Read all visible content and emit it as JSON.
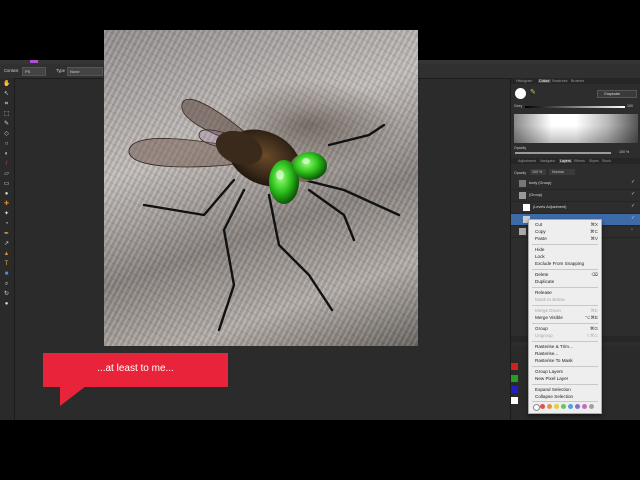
{
  "context_toolbar": {
    "contract_label": "Context",
    "contract_value": "PS",
    "type_label": "Type",
    "type_value": "None"
  },
  "panel": {
    "top_tabs": [
      {
        "label": "Histogram",
        "active": false
      },
      {
        "label": "Colour",
        "active": true
      },
      {
        "label": "Swatches",
        "active": false
      },
      {
        "label": "Brushes",
        "active": false
      }
    ],
    "colour_mode": "Grayscale",
    "grey_label": "Grey",
    "grey_value": "100",
    "opacity_label": "Opacity",
    "opacity_value": "100 %",
    "layer_tabs": [
      {
        "label": "Adjustment",
        "active": false
      },
      {
        "label": "Navigator",
        "active": false
      },
      {
        "label": "Layers",
        "active": true
      },
      {
        "label": "Effects",
        "active": false
      },
      {
        "label": "Styles",
        "active": false
      },
      {
        "label": "Stock",
        "active": false
      }
    ],
    "layer_opacity_label": "Opacity",
    "layer_opacity_value": "100 %",
    "blend_mode": "Normal",
    "layers": [
      {
        "name": "body (Group)",
        "selected": false
      },
      {
        "name": "(Group)",
        "selected": false
      },
      {
        "name": "(Levels Adjustment)",
        "selected": false
      },
      {
        "name": "",
        "selected": true
      },
      {
        "name": "",
        "selected": false
      }
    ]
  },
  "context_menu": {
    "items": [
      {
        "label": "Cut",
        "shortcut": "⌘X",
        "disabled": false
      },
      {
        "label": "Copy",
        "shortcut": "⌘C",
        "disabled": false
      },
      {
        "label": "Paste",
        "shortcut": "⌘V",
        "disabled": false
      },
      {
        "label": "Hide",
        "shortcut": "",
        "disabled": false
      },
      {
        "label": "Lock",
        "shortcut": "",
        "disabled": false
      },
      {
        "label": "Exclude From Snapping",
        "shortcut": "",
        "disabled": false
      },
      {
        "label": "Delete",
        "shortcut": "⌫",
        "disabled": false
      },
      {
        "label": "Duplicate",
        "shortcut": "",
        "disabled": false
      },
      {
        "label": "Release",
        "shortcut": "",
        "disabled": false
      },
      {
        "label": "Mask to Below",
        "shortcut": "",
        "disabled": true
      },
      {
        "label": "Merge Down",
        "shortcut": "⌘E",
        "disabled": true
      },
      {
        "label": "Merge Visible",
        "shortcut": "⌥⌘E",
        "disabled": false
      },
      {
        "label": "Group",
        "shortcut": "⌘G",
        "disabled": false
      },
      {
        "label": "Ungroup",
        "shortcut": "⇧⌘G",
        "disabled": true
      },
      {
        "label": "Rasterise & Trim...",
        "shortcut": "",
        "disabled": false
      },
      {
        "label": "Rasterise...",
        "shortcut": "",
        "disabled": false
      },
      {
        "label": "Rasterise To Mask",
        "shortcut": "",
        "disabled": false
      },
      {
        "label": "Group Layers",
        "shortcut": "",
        "disabled": false
      },
      {
        "label": "New Pixel Layer",
        "shortcut": "",
        "disabled": false
      },
      {
        "label": "Expand Selection",
        "shortcut": "",
        "disabled": false
      },
      {
        "label": "Collapse Selection",
        "shortcut": "",
        "disabled": false
      }
    ],
    "tag_colors": [
      "#999999",
      "#e05050",
      "#e09a40",
      "#e0d040",
      "#70c060",
      "#50a0e0",
      "#8070d0",
      "#c070c0",
      "#a0a0a0"
    ]
  },
  "overlay": {
    "caption": "...at least to me..."
  }
}
